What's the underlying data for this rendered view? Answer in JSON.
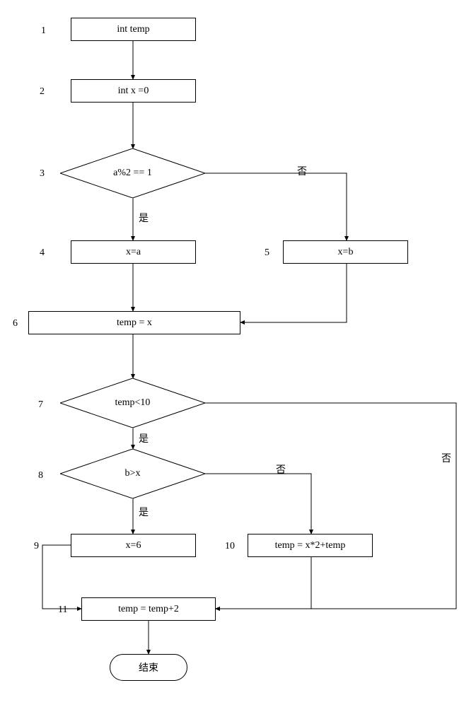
{
  "nodes": {
    "n1": {
      "num": "1",
      "text": "int temp"
    },
    "n2": {
      "num": "2",
      "text": "int x =0"
    },
    "n3": {
      "num": "3",
      "text": "a%2 == 1"
    },
    "n4": {
      "num": "4",
      "text": "x=a"
    },
    "n5": {
      "num": "5",
      "text": "x=b"
    },
    "n6": {
      "num": "6",
      "text": "temp = x"
    },
    "n7": {
      "num": "7",
      "text": "temp<10"
    },
    "n8": {
      "num": "8",
      "text": "b>x"
    },
    "n9": {
      "num": "9",
      "text": "x=6"
    },
    "n10": {
      "num": "10",
      "text": "temp = x*2+temp"
    },
    "n11": {
      "num": "11",
      "text": "temp = temp+2"
    },
    "end": {
      "text": "结束"
    }
  },
  "edges": {
    "yes": "是",
    "no": "否"
  },
  "chart_data": {
    "type": "flowchart",
    "nodes": [
      {
        "id": 1,
        "shape": "process",
        "label": "int temp"
      },
      {
        "id": 2,
        "shape": "process",
        "label": "int x =0"
      },
      {
        "id": 3,
        "shape": "decision",
        "label": "a%2 == 1"
      },
      {
        "id": 4,
        "shape": "process",
        "label": "x=a"
      },
      {
        "id": 5,
        "shape": "process",
        "label": "x=b"
      },
      {
        "id": 6,
        "shape": "process",
        "label": "temp = x"
      },
      {
        "id": 7,
        "shape": "decision",
        "label": "temp<10"
      },
      {
        "id": 8,
        "shape": "decision",
        "label": "b>x"
      },
      {
        "id": 9,
        "shape": "process",
        "label": "x=6"
      },
      {
        "id": 10,
        "shape": "process",
        "label": "temp = x*2+temp"
      },
      {
        "id": 11,
        "shape": "process",
        "label": "temp = temp+2"
      },
      {
        "id": "end",
        "shape": "terminator",
        "label": "结束"
      }
    ],
    "edges": [
      {
        "from": 1,
        "to": 2
      },
      {
        "from": 2,
        "to": 3
      },
      {
        "from": 3,
        "to": 4,
        "label": "是"
      },
      {
        "from": 3,
        "to": 5,
        "label": "否"
      },
      {
        "from": 4,
        "to": 6
      },
      {
        "from": 5,
        "to": 6
      },
      {
        "from": 6,
        "to": 7
      },
      {
        "from": 7,
        "to": 8,
        "label": "是"
      },
      {
        "from": 7,
        "to": 11,
        "label": "否"
      },
      {
        "from": 8,
        "to": 9,
        "label": "是"
      },
      {
        "from": 8,
        "to": 10,
        "label": "否"
      },
      {
        "from": 9,
        "to": 11
      },
      {
        "from": 10,
        "to": 11
      },
      {
        "from": 11,
        "to": "end"
      }
    ]
  }
}
